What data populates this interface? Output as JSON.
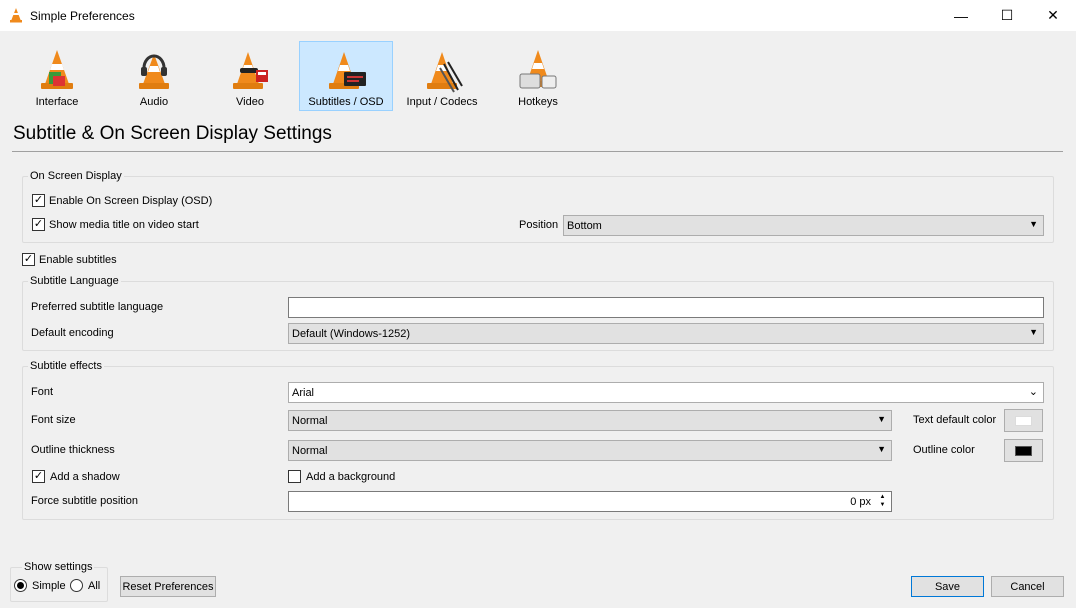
{
  "window": {
    "title": "Simple Preferences",
    "minimize_glyph": "—",
    "maximize_glyph": "☐",
    "close_glyph": "✕"
  },
  "categories": [
    {
      "label": "Interface",
      "icon": "interface-cone-icon"
    },
    {
      "label": "Audio",
      "icon": "audio-cone-icon"
    },
    {
      "label": "Video",
      "icon": "video-cone-icon"
    },
    {
      "label": "Subtitles / OSD",
      "icon": "subtitles-cone-icon",
      "selected": true
    },
    {
      "label": "Input / Codecs",
      "icon": "input-codecs-cone-icon"
    },
    {
      "label": "Hotkeys",
      "icon": "hotkeys-cone-icon"
    }
  ],
  "page": {
    "title": "Subtitle & On Screen Display Settings"
  },
  "osd": {
    "group_label": "On Screen Display",
    "enable_osd_label": "Enable On Screen Display (OSD)",
    "enable_osd_checked": true,
    "show_title_label": "Show media title on video start",
    "show_title_checked": true,
    "position_label": "Position",
    "position_value": "Bottom"
  },
  "subtitles": {
    "enable_label": "Enable subtitles",
    "enable_checked": true
  },
  "language": {
    "group_label": "Subtitle Language",
    "preferred_label": "Preferred subtitle language",
    "preferred_value": "",
    "encoding_label": "Default encoding",
    "encoding_value": "Default (Windows-1252)"
  },
  "effects": {
    "group_label": "Subtitle effects",
    "font_label": "Font",
    "font_value": "Arial",
    "font_size_label": "Font size",
    "font_size_value": "Normal",
    "outline_label": "Outline thickness",
    "outline_value": "Normal",
    "text_color_label": "Text default color",
    "text_color": "#ffffff",
    "outline_color_label": "Outline color",
    "outline_color": "#000000",
    "shadow_label": "Add a shadow",
    "shadow_checked": true,
    "background_label": "Add a background",
    "background_checked": false,
    "force_position_label": "Force subtitle position",
    "force_position_value": "0 px"
  },
  "footer": {
    "show_settings_label": "Show settings",
    "simple_label": "Simple",
    "all_label": "All",
    "selected_mode": "Simple",
    "reset_label": "Reset Preferences",
    "save_label": "Save",
    "cancel_label": "Cancel"
  },
  "colors": {
    "selection_bg": "#cce8ff",
    "selection_border": "#99d1ff",
    "accent": "#0078d7",
    "cone_orange": "#f08a1c"
  }
}
